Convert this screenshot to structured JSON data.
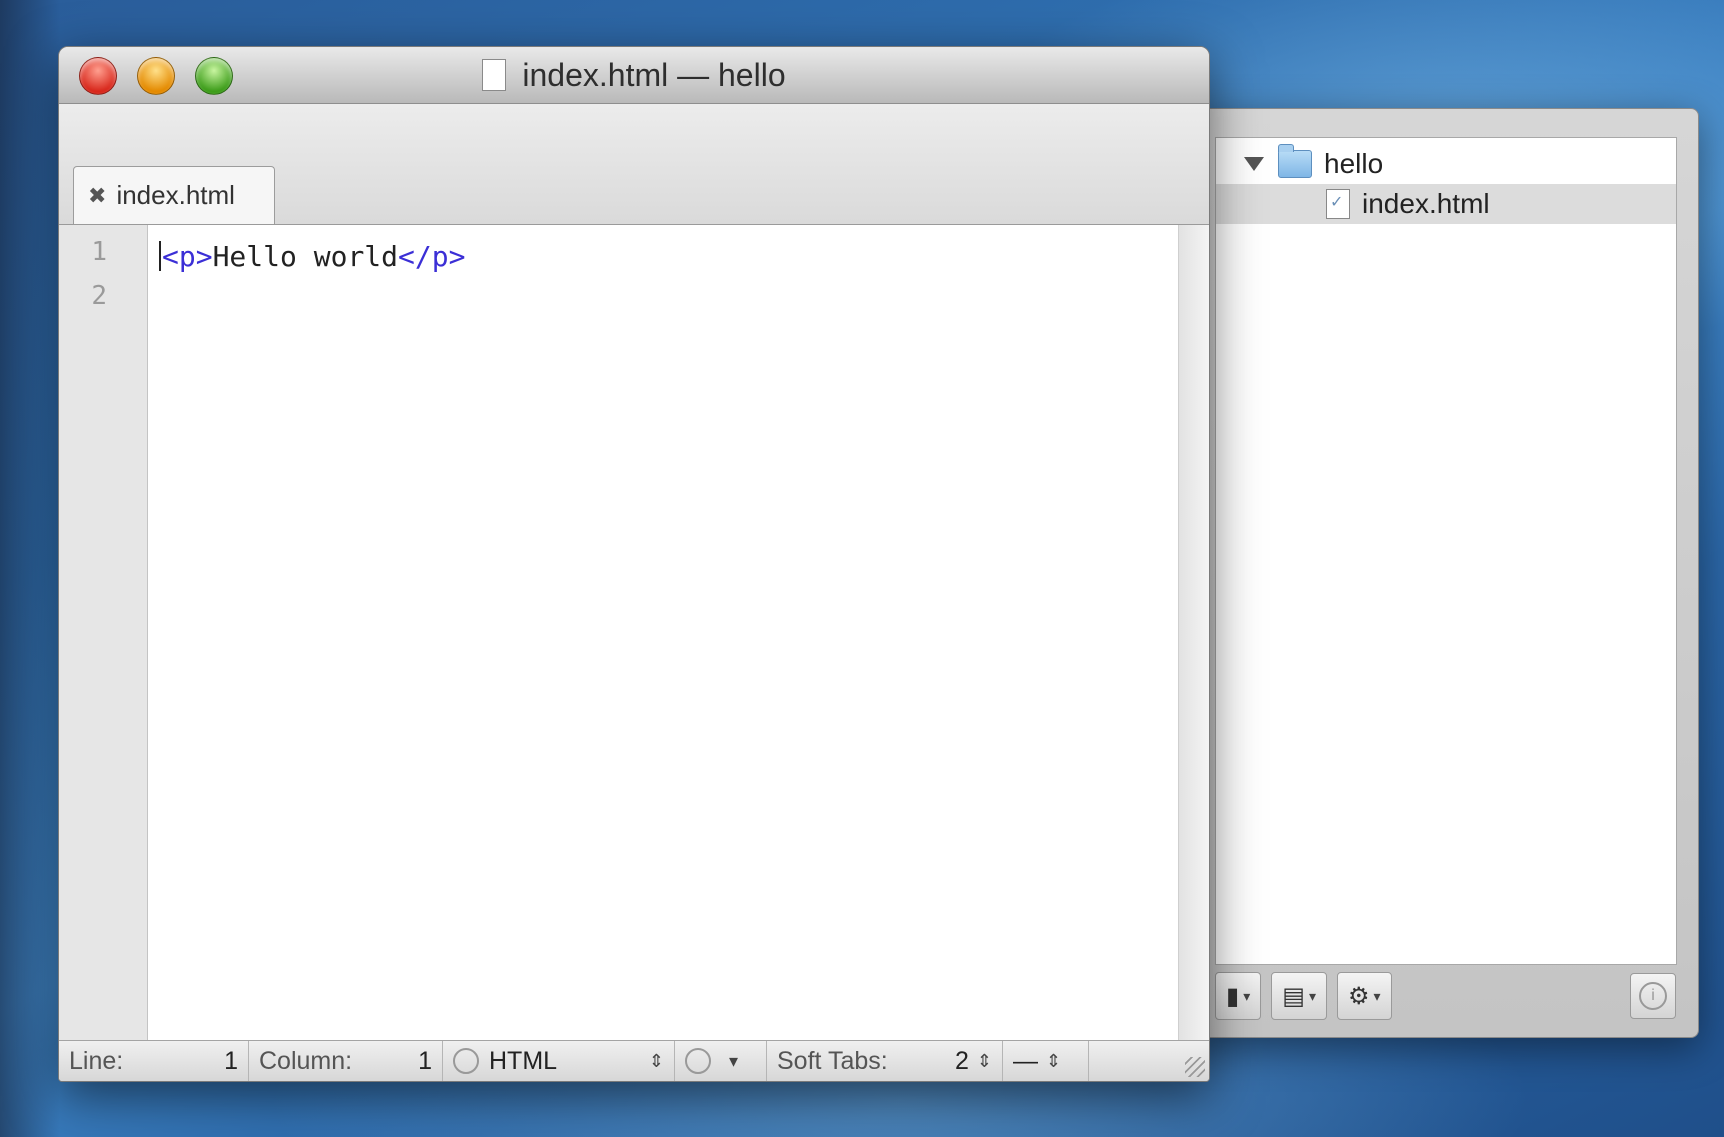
{
  "window": {
    "title": "index.html — hello"
  },
  "tabs": [
    {
      "label": "index.html",
      "close_glyph": "✖"
    }
  ],
  "editor": {
    "line_numbers": [
      "1",
      "2"
    ],
    "code_line1": {
      "open_tag": "<p>",
      "text": "Hello world",
      "close_tag": "</p>"
    },
    "tag_color": "#3b2fd6"
  },
  "statusbar": {
    "line_label": "Line:",
    "line_value": "1",
    "column_label": "Column:",
    "column_value": "1",
    "language": "HTML",
    "soft_tabs_label": "Soft Tabs:",
    "soft_tabs_value": "2",
    "symbol_value": "—"
  },
  "project_drawer": {
    "root_label": "hello",
    "child_label": "index.html",
    "toolbar": {
      "new_file_icon": "new-file-icon",
      "new_folder_icon": "new-folder-icon",
      "action_icon": "gear-icon",
      "info_icon": "info-icon"
    }
  }
}
